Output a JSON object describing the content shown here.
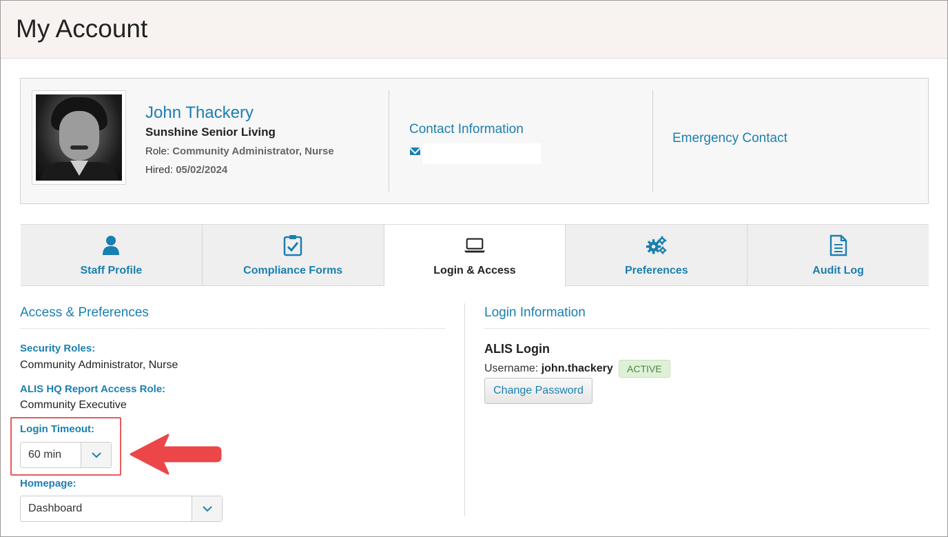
{
  "page": {
    "title": "My Account"
  },
  "profile": {
    "name": "John Thackery",
    "organization": "Sunshine Senior Living",
    "role_label": "Role:",
    "role_value": "Community Administrator, Nurse",
    "hired_label": "Hired:",
    "hired_value": "05/02/2024",
    "contact_title": "Contact Information",
    "email": "",
    "emergency_title": "Emergency Contact"
  },
  "tabs": [
    {
      "label": "Staff Profile",
      "icon": "user-icon",
      "active": false
    },
    {
      "label": "Compliance Forms",
      "icon": "clipboard-check-icon",
      "active": false
    },
    {
      "label": "Login & Access",
      "icon": "laptop-icon",
      "active": true
    },
    {
      "label": "Preferences",
      "icon": "gears-icon",
      "active": false
    },
    {
      "label": "Audit Log",
      "icon": "document-icon",
      "active": false
    }
  ],
  "access": {
    "title": "Access & Preferences",
    "security_roles_label": "Security Roles:",
    "security_roles_value": "Community Administrator, Nurse",
    "report_role_label": "ALIS HQ Report Access Role:",
    "report_role_value": "Community Executive",
    "timeout_label": "Login Timeout:",
    "timeout_value": "60 min",
    "homepage_label": "Homepage:",
    "homepage_value": "Dashboard"
  },
  "login": {
    "title": "Login Information",
    "system": "ALIS Login",
    "username_label": "Username:",
    "username": "john.thackery",
    "status": "ACTIVE",
    "change_password": "Change Password"
  },
  "colors": {
    "accent": "#1a7fb0",
    "highlight": "#e8585c",
    "badge_bg": "#dff0d8",
    "badge_text": "#4a8a3a",
    "header_bg": "#f8f3f1"
  }
}
